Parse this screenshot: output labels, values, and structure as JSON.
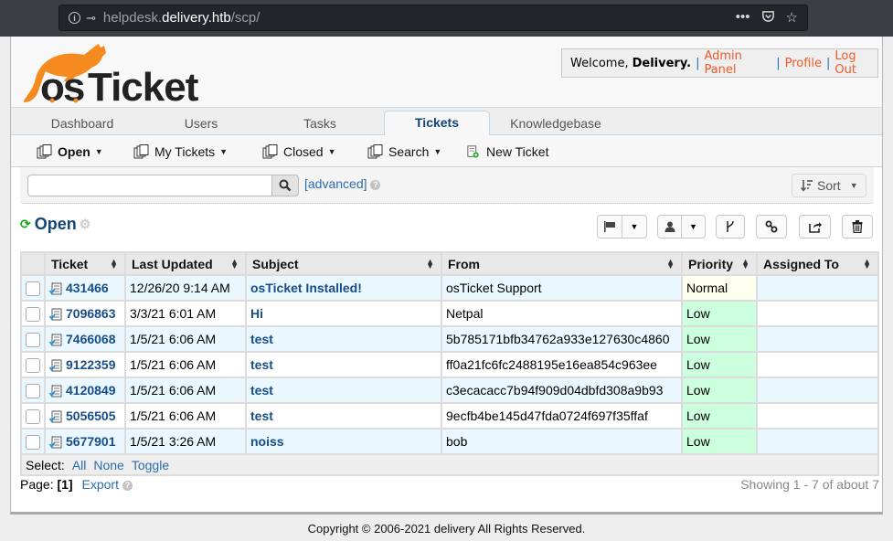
{
  "browser": {
    "url_prefix": "helpdesk.",
    "url_host": "delivery.htb",
    "url_path": "/scp/",
    "more_label": "•••"
  },
  "header": {
    "logo_text": "osTicket",
    "welcome_prefix": "Welcome,",
    "user_name": "Delivery.",
    "links": [
      "Admin Panel",
      "Profile",
      "Log Out"
    ]
  },
  "nav": {
    "tabs": [
      {
        "label": "Dashboard",
        "active": false
      },
      {
        "label": "Users",
        "active": false
      },
      {
        "label": "Tasks",
        "active": false
      },
      {
        "label": "Tickets",
        "active": true
      },
      {
        "label": "Knowledgebase",
        "active": false
      }
    ]
  },
  "subnav": {
    "items": [
      {
        "label": "Open",
        "dropdown": true
      },
      {
        "label": "My Tickets",
        "dropdown": true
      },
      {
        "label": "Closed",
        "dropdown": true
      },
      {
        "label": "Search",
        "dropdown": true
      },
      {
        "label": "New Ticket",
        "dropdown": false
      }
    ]
  },
  "search": {
    "value": "",
    "placeholder": "",
    "advanced_label": "[advanced]",
    "sort_label": "Sort"
  },
  "queue": {
    "title": "Open"
  },
  "table": {
    "columns": [
      "Ticket",
      "Last Updated",
      "Subject",
      "From",
      "Priority",
      "Assigned To"
    ],
    "rows": [
      {
        "number": "431466",
        "updated": "12/26/20 9:14 AM",
        "subject": "osTicket Installed!",
        "from": "osTicket Support",
        "priority": "Normal",
        "assigned": ""
      },
      {
        "number": "7096863",
        "updated": "3/3/21 6:01 AM",
        "subject": "Hi",
        "from": "Netpal",
        "priority": "Low",
        "assigned": ""
      },
      {
        "number": "7466068",
        "updated": "1/5/21 6:06 AM",
        "subject": "test",
        "from": "5b785171bfb34762a933e127630c4860",
        "priority": "Low",
        "assigned": ""
      },
      {
        "number": "9122359",
        "updated": "1/5/21 6:06 AM",
        "subject": "test",
        "from": "ff0a21fc6fc2488195e16ea854c963ee",
        "priority": "Low",
        "assigned": ""
      },
      {
        "number": "4120849",
        "updated": "1/5/21 6:06 AM",
        "subject": "test",
        "from": "c3ecacacc7b94f909d04dbfd308a9b93",
        "priority": "Low",
        "assigned": ""
      },
      {
        "number": "5056505",
        "updated": "1/5/21 6:06 AM",
        "subject": "test",
        "from": "9ecfb4be145d47fda0724f697f35ffaf",
        "priority": "Low",
        "assigned": ""
      },
      {
        "number": "5677901",
        "updated": "1/5/21 3:26 AM",
        "subject": "noiss",
        "from": "bob",
        "priority": "Low",
        "assigned": ""
      }
    ],
    "select_label": "Select:",
    "select_links": [
      "All",
      "None",
      "Toggle"
    ]
  },
  "pagination": {
    "page_label": "Page:",
    "current_page": "[1]",
    "export_label": "Export",
    "showing": "Showing 1 - 7 of about 7"
  },
  "footer": {
    "copyright": "Copyright © 2006-2021 delivery All Rights Reserved."
  },
  "colors": {
    "link": "#2a6cb0",
    "ticket_link": "#184e87",
    "accent_orange": "#f58220",
    "priority_low": "#ccffdd",
    "priority_normal": "#fffff0"
  }
}
